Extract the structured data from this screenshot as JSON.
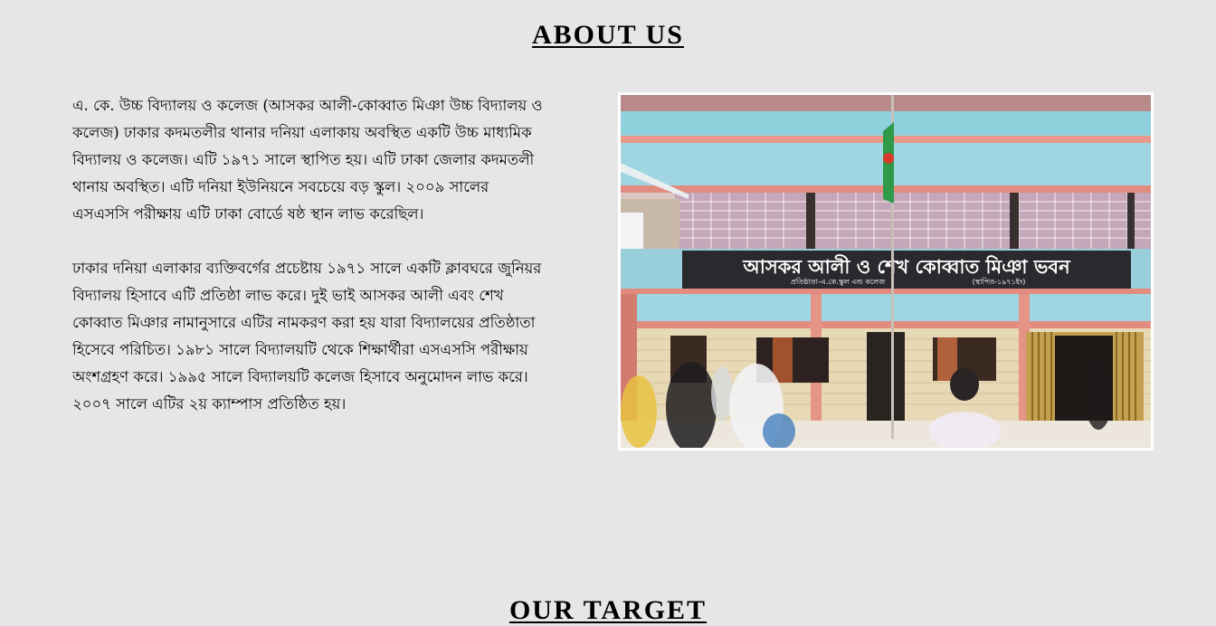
{
  "about": {
    "title": "ABOUT US",
    "paragraphs": [
      "এ. কে. উচ্চ বিদ্যালয় ও কলেজ (আসকর আলী-কোব্বাত মিঞা উচ্চ বিদ্যালয় ও কলেজ) ঢাকার কদমতলীর থানার দনিয়া এলাকায় অবস্থিত একটি উচ্চ মাধ্যমিক বিদ্যালয় ও কলেজ। এটি ১৯৭১ সালে স্থাপিত হয়। এটি ঢাকা জেলার কদমতলী থানায় অবস্থিত। এটি দনিয়া ইউনিয়নে সবচেয়ে বড় স্কুল। ২০০৯ সালের এসএসসি পরীক্ষায় এটি ঢাকা বোর্ডে ষষ্ঠ স্থান লাভ করেছিল।",
      "ঢাকার দনিয়া এলাকার ব্যক্তিবর্গের প্রচেষ্টায় ১৯৭১ সালে একটি ক্লাবঘরে জুনিয়র বিদ্যালয় হিসাবে এটি প্রতিষ্ঠা লাভ করে। দুই ভাই আসকর আলী এবং শেখ কোব্বাত মিঞার নামানুসারে এটির নামকরণ করা হয় যারা বিদ্যালয়ের প্রতিষ্ঠাতা হিসেবে পরিচিত। ১৯৮১ সালে বিদ্যালয়টি থেকে শিক্ষার্থীরা এসএসসি পরীক্ষায় অংশগ্রহণ করে। ১৯৯৫ সালে বিদ্যালয়টি কলেজ হিসাবে অনুমোদন লাভ করে। ২০০৭ সালে এটির ২য় ক্যাম্পাস প্রতিষ্ঠিত হয়।"
    ],
    "photo": {
      "sign_main": "আসকর আলী ও শেখ কোব্বাত মিঞা ভবন",
      "sign_sub_left": "প্রতিষ্ঠাতা-এ.কে.স্কুল এন্ড কলেজ",
      "sign_sub_right": "(স্থাপিত-১৯৭১ইং)"
    }
  },
  "target": {
    "title": "OUR TARGET"
  }
}
